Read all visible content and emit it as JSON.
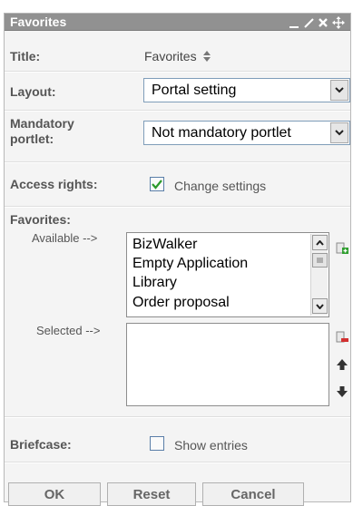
{
  "window": {
    "title": "Favorites"
  },
  "titlebar_icons": [
    "minimize-icon",
    "edit-icon",
    "close-icon",
    "move-icon"
  ],
  "form": {
    "title_label": "Title:",
    "title_value": "Favorites",
    "layout_label": "Layout:",
    "layout_value": "Portal setting",
    "mandatory_label": "Mandatory portlet:",
    "mandatory_value": "Not mandatory portlet",
    "access_label": "Access rights:",
    "access_checked": true,
    "access_text": "Change settings",
    "favorites_label": "Favorites:",
    "available_label": "Available -->",
    "available_items": [
      "BizWalker",
      "Empty Application",
      "Library",
      "Order proposal"
    ],
    "selected_label": "Selected -->",
    "selected_items": [],
    "briefcase_label": "Briefcase:",
    "briefcase_checked": false,
    "briefcase_text": "Show entries"
  },
  "buttons": {
    "ok": "OK",
    "reset": "Reset",
    "cancel": "Cancel"
  },
  "colors": {
    "titlebar": "#919191",
    "panel": "#f4f4f4",
    "label": "#555555",
    "check": "#2c9a2c",
    "add": "#2e9e2e",
    "remove": "#d23030"
  }
}
